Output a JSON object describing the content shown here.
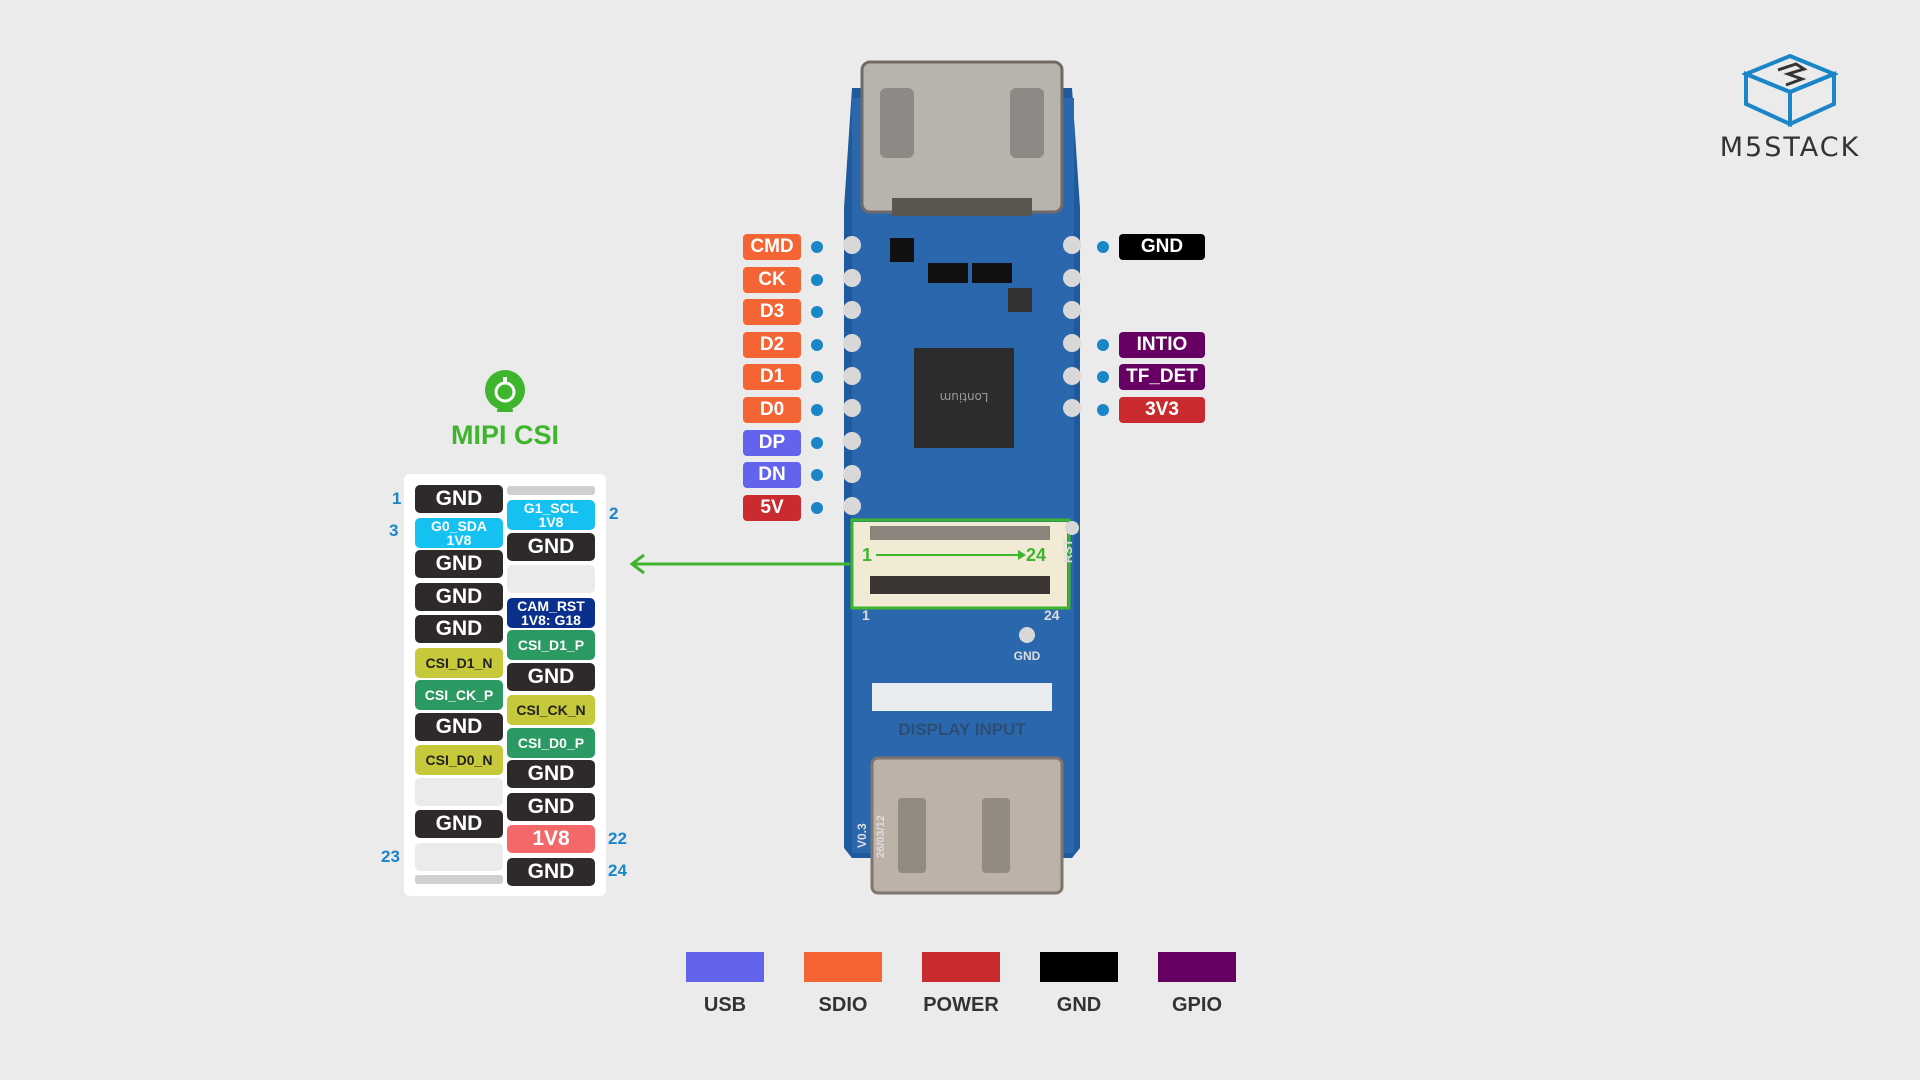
{
  "brand": {
    "name": "M5STACK"
  },
  "colors": {
    "usb": "#6463ee",
    "sdio": "#f46434",
    "power": "#c92b2e",
    "gnd": "#000000",
    "gpio": "#660063",
    "mipi_accent": "#3fb52d",
    "pin_dot": "#1a86c8"
  },
  "left_pins": [
    {
      "label": "CMD",
      "group": "sdio"
    },
    {
      "label": "CK",
      "group": "sdio"
    },
    {
      "label": "D3",
      "group": "sdio"
    },
    {
      "label": "D2",
      "group": "sdio"
    },
    {
      "label": "D1",
      "group": "sdio"
    },
    {
      "label": "D0",
      "group": "sdio"
    },
    {
      "label": "DP",
      "group": "usb"
    },
    {
      "label": "DN",
      "group": "usb"
    },
    {
      "label": "5V",
      "group": "power"
    }
  ],
  "right_pins": [
    {
      "label": "GND",
      "group": "gnd",
      "row": 0
    },
    {
      "label": "INTIO",
      "group": "gpio",
      "row": 3
    },
    {
      "label": "TF_DET",
      "group": "gpio",
      "row": 4
    },
    {
      "label": "3V3",
      "group": "power",
      "row": 5
    }
  ],
  "board": {
    "display_input_label": "DISPLAY INPUT",
    "version": "V0.3",
    "date": "26/03/12",
    "chip_brand": "Lontium",
    "rst_label": "RST",
    "gnd_label": "GND",
    "fpc_start": "1",
    "fpc_end": "24"
  },
  "mipi": {
    "title": "MIPI CSI",
    "icon": "camera-icon",
    "pin_numbers": {
      "one": "1",
      "two": "2",
      "three": "3",
      "twentytwo": "22",
      "twentythree": "23",
      "twentyfour": "24"
    },
    "left_column": [
      {
        "label": "GND",
        "color": "gnd"
      },
      {
        "label": "G0_SDA\n1V8",
        "color": "i2c"
      },
      {
        "label": "GND",
        "color": "gnd"
      },
      {
        "label": "GND",
        "color": "gnd"
      },
      {
        "label": "GND",
        "color": "gnd"
      },
      {
        "label": "CSI_D1_N",
        "color": "csi_n"
      },
      {
        "label": "CSI_CK_P",
        "color": "csi_p"
      },
      {
        "label": "GND",
        "color": "gnd"
      },
      {
        "label": "CSI_D0_N",
        "color": "csi_n"
      },
      {
        "label": "",
        "color": "empty"
      },
      {
        "label": "GND",
        "color": "gnd"
      },
      {
        "label": "",
        "color": "empty"
      }
    ],
    "right_column": [
      {
        "label": "G1_SCL\n1V8",
        "color": "i2c"
      },
      {
        "label": "GND",
        "color": "gnd"
      },
      {
        "label": "",
        "color": "empty"
      },
      {
        "label": "CAM_RST\n1V8: G18",
        "color": "rst"
      },
      {
        "label": "CSI_D1_P",
        "color": "csi_p"
      },
      {
        "label": "GND",
        "color": "gnd"
      },
      {
        "label": "CSI_CK_N",
        "color": "csi_n"
      },
      {
        "label": "CSI_D0_P",
        "color": "csi_p"
      },
      {
        "label": "GND",
        "color": "gnd"
      },
      {
        "label": "GND",
        "color": "gnd"
      },
      {
        "label": "1V8",
        "color": "v18"
      },
      {
        "label": "GND",
        "color": "gnd"
      }
    ],
    "cell_colors": {
      "gnd": "#2f2a2a",
      "i2c": "#15c1f0",
      "csi_n": "#c6c93a",
      "csi_p": "#2a9a62",
      "rst": "#0a2f8c",
      "v18": "#f4686a",
      "empty": "#ebebeb"
    }
  },
  "legend": [
    {
      "label": "USB",
      "color": "#6463ee"
    },
    {
      "label": "SDIO",
      "color": "#f46434"
    },
    {
      "label": "POWER",
      "color": "#c92b2e"
    },
    {
      "label": "GND",
      "color": "#000000"
    },
    {
      "label": "GPIO",
      "color": "#660063"
    }
  ]
}
